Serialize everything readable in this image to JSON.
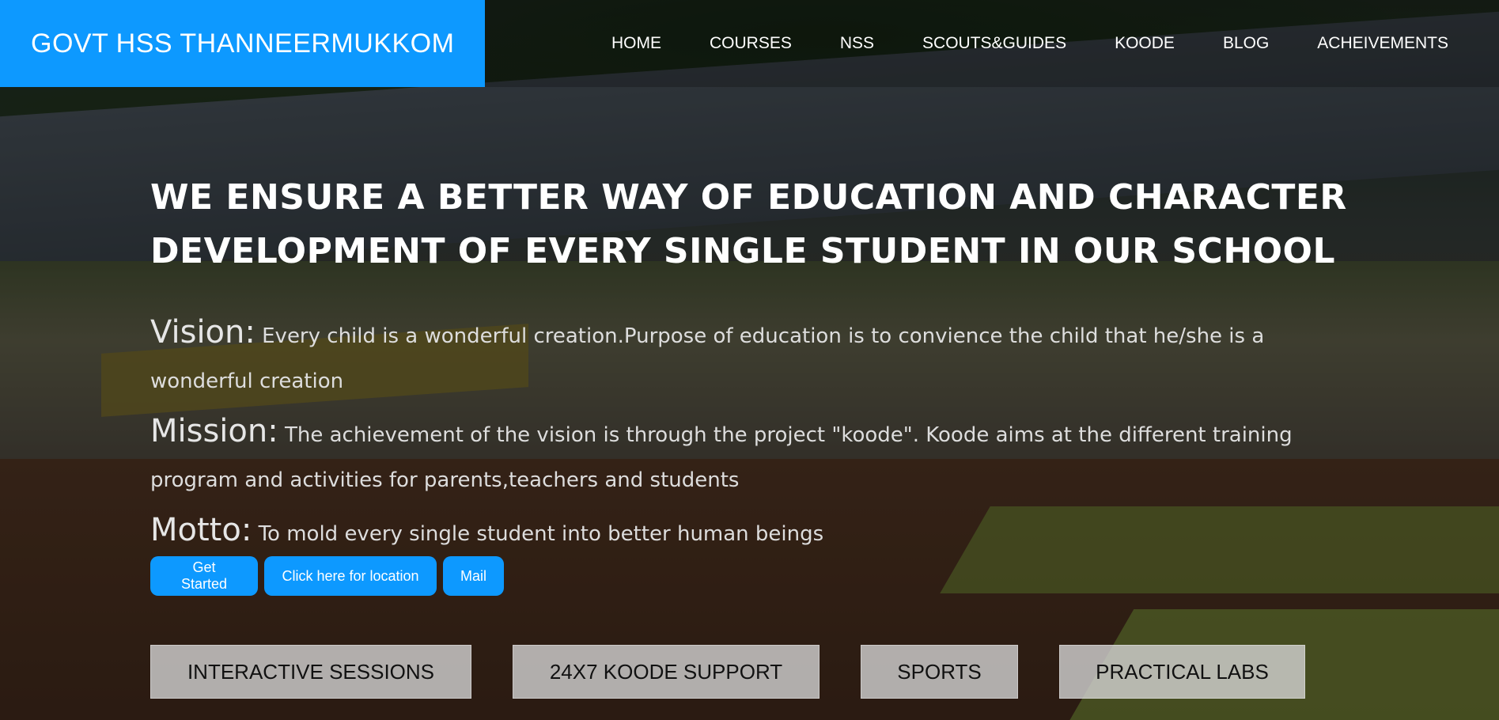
{
  "brand": {
    "name": "GOVT HSS THANNEERMUKKOM"
  },
  "nav": {
    "items": [
      "HOME",
      "COURSES",
      "NSS",
      "SCOUTS&GUIDES",
      "KOODE",
      "BLOG",
      "ACHEIVEMENTS"
    ]
  },
  "hero": {
    "headline": "WE ENSURE A BETTER WAY OF EDUCATION AND CHARACTER DEVELOPMENT OF EVERY SINGLE STUDENT IN OUR SCHOOL",
    "vision": {
      "label": "Vision:",
      "text": "Every child is a wonderful creation.Purpose of education is to convience the child that he/she is a wonderful creation"
    },
    "mission": {
      "label": "Mission:",
      "text": "The achievement of the vision is through the project \"koode\". Koode aims at the different training program and activities for parents,teachers and students"
    },
    "motto": {
      "label": "Motto:",
      "text": "To mold every single student into better human beings"
    }
  },
  "actions": {
    "get_started": "Get Started",
    "location": "Click here for location",
    "mail": "Mail"
  },
  "features": [
    "INTERACTIVE SESSIONS",
    "24X7 KOODE SUPPORT",
    "SPORTS",
    "PRACTICAL LABS"
  ],
  "colors": {
    "accent": "#0d99ff",
    "feature_bg": "#d7d7d7"
  }
}
